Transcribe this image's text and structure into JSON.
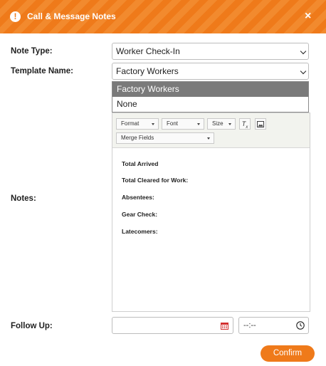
{
  "header": {
    "title": "Call & Message Notes",
    "close_label": "×"
  },
  "form": {
    "note_type_label": "Note Type:",
    "note_type_value": "Worker Check-In",
    "template_label": "Template Name:",
    "template_value": "Factory Workers",
    "template_options": [
      "Factory Workers",
      "None"
    ],
    "notes_label": "Notes:",
    "follow_up_label": "Follow Up:",
    "time_placeholder": "--:--"
  },
  "editor": {
    "toolbar": {
      "format_label": "Format",
      "font_label": "Font",
      "size_label": "Size",
      "merge_fields_label": "Merge Fields"
    },
    "lines": [
      "Total Arrived",
      "Total Cleared for Work:",
      "Absentees:",
      "Gear Check:",
      "Latecomers:"
    ]
  },
  "actions": {
    "confirm_label": "Confirm"
  },
  "colors": {
    "accent": "#ef7a1a",
    "selected_option": "#7a7a7a"
  }
}
